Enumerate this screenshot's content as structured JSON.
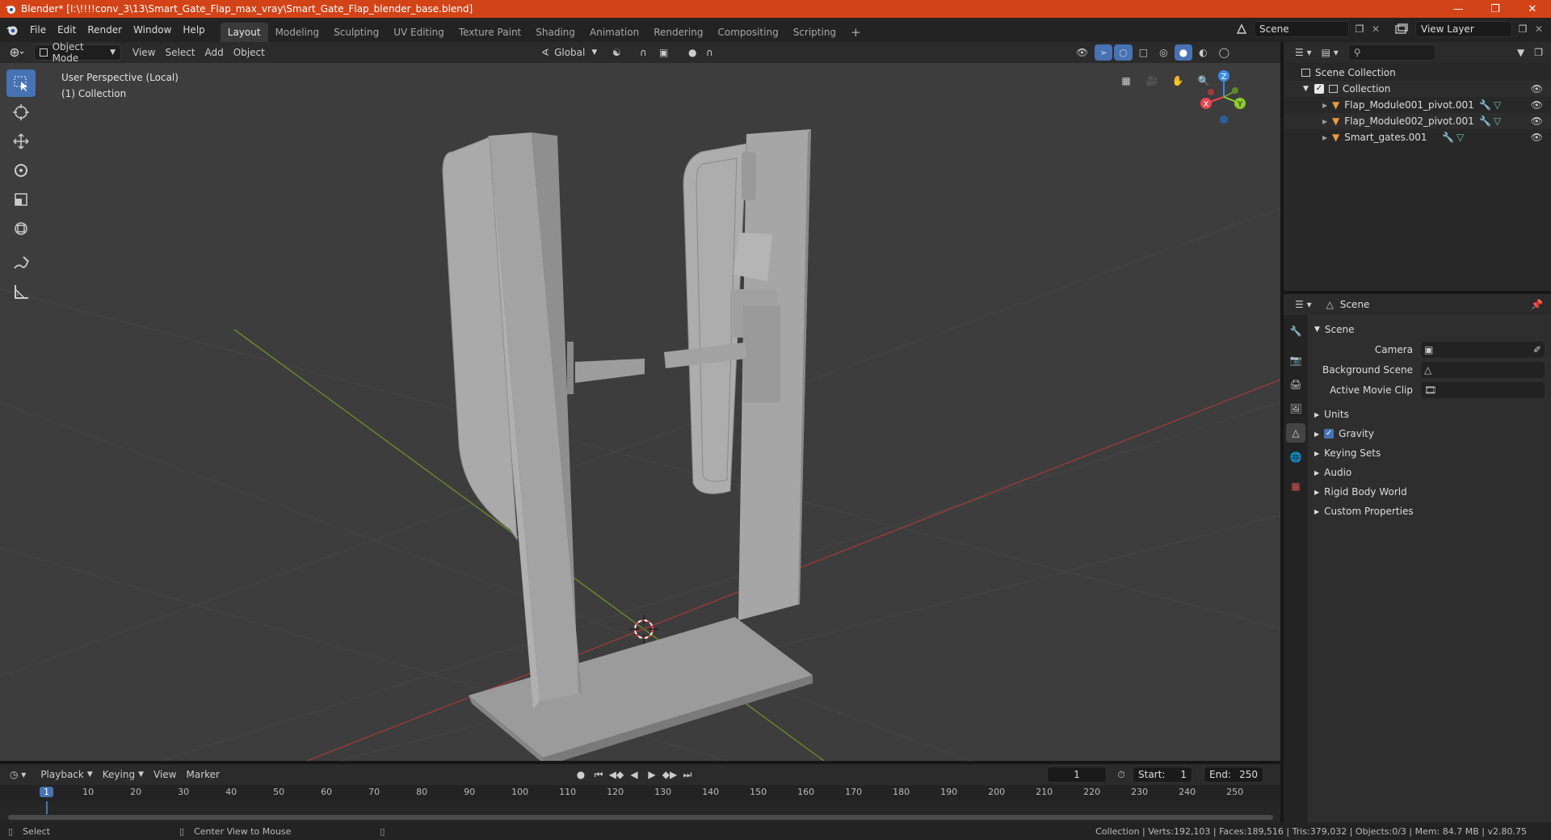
{
  "window": {
    "title": "Blender* [I:\\!!!!conv_3\\13\\Smart_Gate_Flap_max_vray\\Smart_Gate_Flap_blender_base.blend]",
    "controls": [
      "minimize",
      "maximize",
      "close"
    ]
  },
  "menu": [
    "File",
    "Edit",
    "Render",
    "Window",
    "Help"
  ],
  "workspaces": [
    {
      "label": "Layout",
      "active": true
    },
    {
      "label": "Modeling",
      "active": false
    },
    {
      "label": "Sculpting",
      "active": false
    },
    {
      "label": "UV Editing",
      "active": false
    },
    {
      "label": "Texture Paint",
      "active": false
    },
    {
      "label": "Shading",
      "active": false
    },
    {
      "label": "Animation",
      "active": false
    },
    {
      "label": "Rendering",
      "active": false
    },
    {
      "label": "Compositing",
      "active": false
    },
    {
      "label": "Scripting",
      "active": false
    }
  ],
  "scene_selector": {
    "value": "Scene"
  },
  "view_layer_selector": {
    "value": "View Layer"
  },
  "viewport_header": {
    "mode": "Object Mode",
    "menus": [
      "View",
      "Select",
      "Add",
      "Object"
    ],
    "transform_orientation": "Global"
  },
  "viewport": {
    "info_line1": "User Perspective (Local)",
    "info_line2": "(1) Collection",
    "gizmo_axes": [
      "Z",
      "X",
      "Y"
    ]
  },
  "tools": [
    "select-box",
    "cursor",
    "move",
    "rotate",
    "scale",
    "transform",
    "annotate",
    "measure"
  ],
  "outliner": {
    "root": "Scene Collection",
    "collection": "Collection",
    "objects": [
      "Flap_Module001_pivot.001",
      "Flap_Module002_pivot.001",
      "Smart_gates.001"
    ]
  },
  "properties": {
    "header": "Scene",
    "section": "Scene",
    "fields": [
      {
        "label": "Camera",
        "value": ""
      },
      {
        "label": "Background Scene",
        "value": ""
      },
      {
        "label": "Active Movie Clip",
        "value": ""
      }
    ],
    "panels": [
      {
        "label": "Units",
        "checkbox": false
      },
      {
        "label": "Gravity",
        "checkbox": true
      },
      {
        "label": "Keying Sets",
        "checkbox": false
      },
      {
        "label": "Audio",
        "checkbox": false
      },
      {
        "label": "Rigid Body World",
        "checkbox": false
      },
      {
        "label": "Custom Properties",
        "checkbox": false
      }
    ]
  },
  "timeline": {
    "menus": [
      "Playback",
      "Keying",
      "View",
      "Marker"
    ],
    "current_frame": "1",
    "start_label": "Start:",
    "start": "1",
    "end_label": "End:",
    "end": "250",
    "ruler": [
      "1",
      "10",
      "20",
      "30",
      "40",
      "50",
      "60",
      "70",
      "80",
      "90",
      "100",
      "110",
      "120",
      "130",
      "140",
      "150",
      "160",
      "170",
      "180",
      "190",
      "200",
      "210",
      "220",
      "230",
      "240",
      "250"
    ]
  },
  "statusbar": {
    "select": "Select",
    "center_view": "Center View to Mouse",
    "stats": "Collection | Verts:192,103 | Faces:189,516 | Tris:379,032 | Objects:0/3 | Mem: 84.7 MB | v2.80.75"
  },
  "colors": {
    "accent": "#4772b3",
    "titlebar": "#d24317",
    "object_orange": "#e89a3c",
    "mesh_green": "#63c7a0",
    "axis_x": "#e8454f",
    "axis_y": "#8ccc2c",
    "axis_z": "#3b8ae6"
  }
}
